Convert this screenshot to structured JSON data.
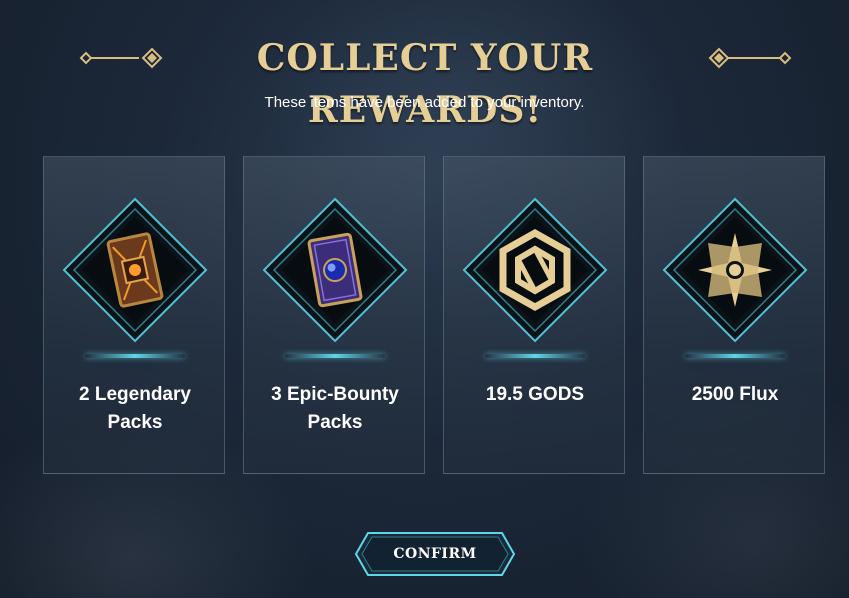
{
  "header": {
    "title": "COLLECT YOUR REWARDS!",
    "subtitle": "These items have been added to your inventory."
  },
  "rewards": [
    {
      "label": "2 Legendary Packs",
      "icon": "legendary-pack-icon"
    },
    {
      "label": "3 Epic-Bounty Packs",
      "icon": "epic-bounty-pack-icon"
    },
    {
      "label": "19.5 GODS",
      "icon": "gods-token-icon"
    },
    {
      "label": "2500 Flux",
      "icon": "flux-star-icon"
    }
  ],
  "actions": {
    "confirm_label": "CONFIRM"
  },
  "colors": {
    "gold": "#e6cf96",
    "accent_cyan": "#5fd6e8",
    "background": "#1c2839"
  }
}
